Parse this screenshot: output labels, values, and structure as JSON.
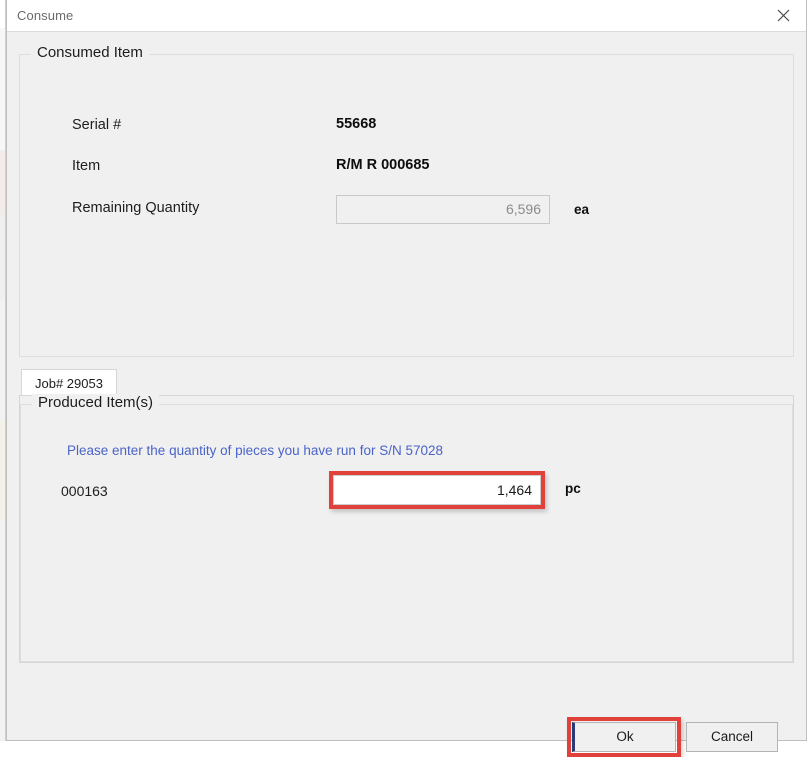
{
  "window": {
    "title": "Consume",
    "close_icon": "close-icon"
  },
  "consumed_section": {
    "legend": "Consumed Item",
    "fields": [
      {
        "label": "Serial #",
        "value": "55668"
      },
      {
        "label": "Item",
        "value": "R/M R 000685"
      }
    ],
    "remaining": {
      "label": "Remaining Quantity",
      "value": "6,596",
      "unit": "ea",
      "enabled": false
    }
  },
  "tabs": [
    {
      "label": "Job# 29053",
      "selected": true
    }
  ],
  "produced_section": {
    "legend": "Produced Item(s)",
    "hint": "Please enter the quantity of pieces you have run for S/N 57028",
    "item_number": "000163",
    "quantity": "1,464",
    "unit": "pc",
    "highlighted": true
  },
  "footer": {
    "ok_label": "Ok",
    "cancel_label": "Cancel"
  },
  "colors": {
    "annotation_red": "#e0413a",
    "hint_blue": "#4a63c8",
    "window_face": "#f0f0f0",
    "focus_navy": "#2b3a78"
  }
}
